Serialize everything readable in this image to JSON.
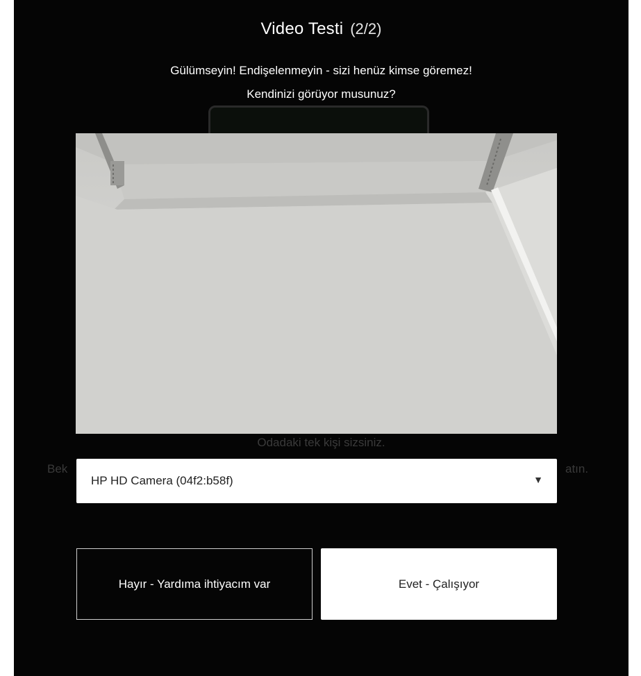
{
  "dialog": {
    "title": "Video Testi",
    "step": "(2/2)",
    "subtitle_line1": "Gülümseyin! Endişelenmeyin - sizi henüz kimse göremez!",
    "subtitle_line2": "Kendinizi görüyor musunuz?"
  },
  "background_hint": {
    "line1": "Odadaki tek kişi sizsiniz.",
    "left_fragment": "Bek",
    "right_fragment": "atın."
  },
  "camera_select": {
    "selected": "HP HD Camera (04f2:b58f)",
    "arrow_icon": "dropdown-triangle-icon"
  },
  "buttons": {
    "no_label": "Hayır - Yardıma ihtiyacım var",
    "yes_label": "Evet - Çalışıyor"
  },
  "colors": {
    "dialog_background": "#050505",
    "text": "#ffffff",
    "button_primary_bg": "#ffffff"
  }
}
